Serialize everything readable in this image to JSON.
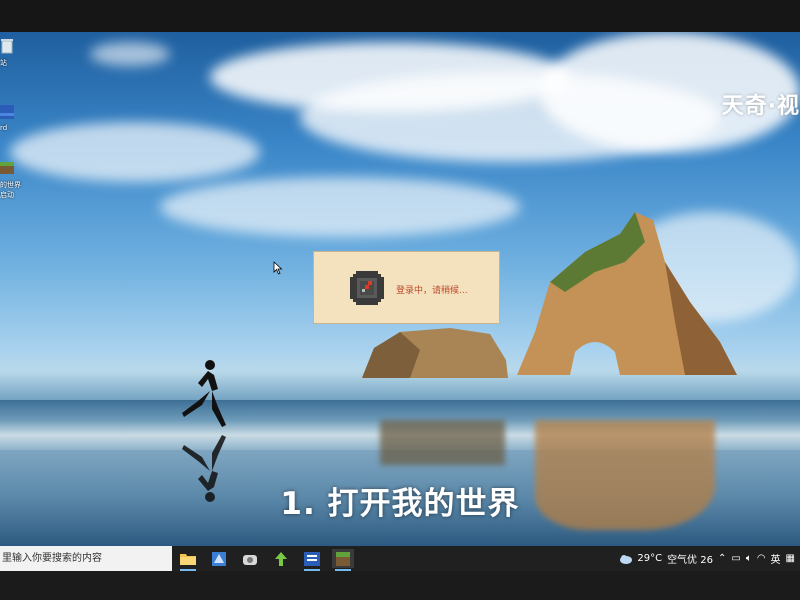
{
  "watermark": "天奇·视",
  "desktop_icons": [
    {
      "label": "站",
      "icon": "recycle-bin-icon"
    },
    {
      "label": "rd",
      "icon": "word-icon"
    },
    {
      "label": "的世界启动",
      "icon": "minecraft-launcher-icon"
    }
  ],
  "dialog": {
    "message": "登录中，请稍候...",
    "icon": "compass-icon"
  },
  "subtitle": "1. 打开我的世界",
  "taskbar": {
    "search_placeholder": "里输入你要搜索的内容",
    "apps": [
      {
        "name": "file-explorer",
        "icon": "folder-icon"
      },
      {
        "name": "remote-app",
        "icon": "blue-app-icon"
      },
      {
        "name": "media-app",
        "icon": "camera-icon"
      },
      {
        "name": "green-app",
        "icon": "up-arrow-icon"
      },
      {
        "name": "word",
        "icon": "word-icon"
      },
      {
        "name": "minecraft",
        "icon": "minecraft-icon"
      }
    ],
    "weather": "29°C",
    "air_quality": "空气优 26",
    "language": "英",
    "colors": {
      "taskbar_bg": "#202020",
      "active_indicator": "#76b9ed"
    }
  }
}
